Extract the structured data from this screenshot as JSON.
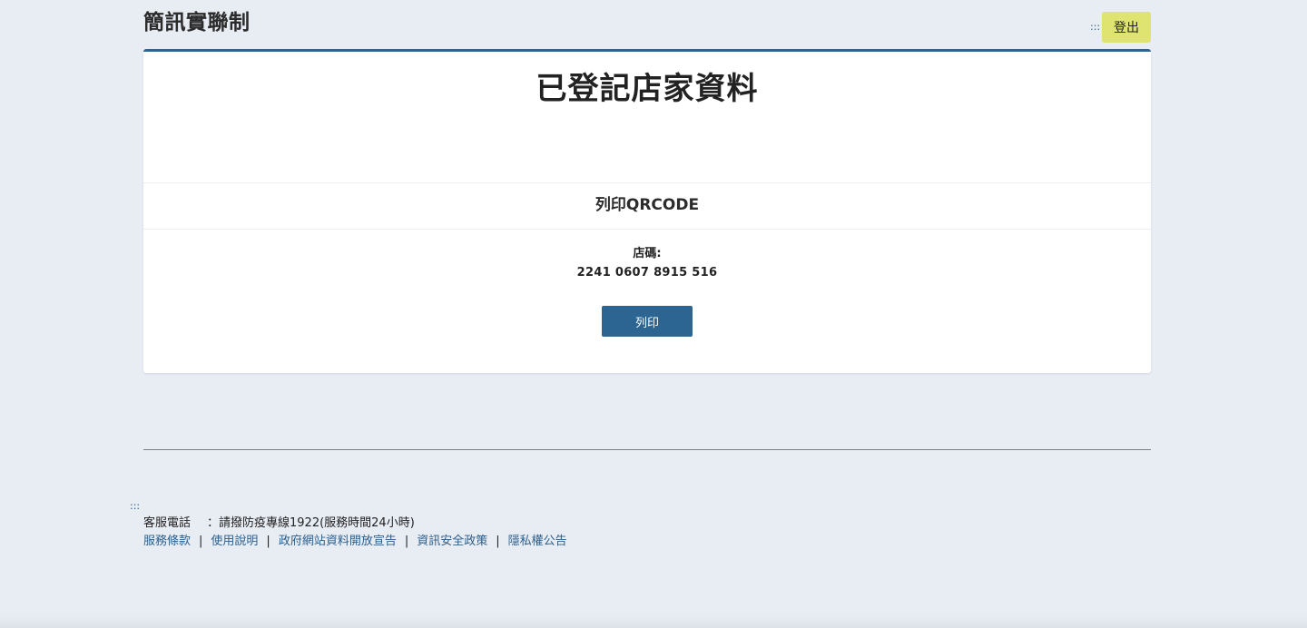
{
  "header": {
    "site_title": "簡訊實聯制",
    "accesskey_top": ":::",
    "logout_label": "登出"
  },
  "card": {
    "title": "已登記店家資料",
    "section_heading": "列印QRCODE",
    "store_code_label": "店碼:",
    "store_code_value": "2241 0607 8915 516",
    "print_label": "列印"
  },
  "footer": {
    "accesskey_bottom": ":::",
    "phone_label": "客服電話",
    "phone_text": "：請撥防疫專線1922(服務時間24小時)",
    "links": [
      {
        "label": "服務條款"
      },
      {
        "label": "使用說明"
      },
      {
        "label": "政府網站資料開放宣告"
      },
      {
        "label": "資訊安全政策"
      },
      {
        "label": "隱私權公告"
      }
    ],
    "separator": "|"
  },
  "colors": {
    "background": "#e8ecf3",
    "accent_blue": "#2c6592",
    "logout_yellow": "#dfe36f",
    "link_blue": "#2b5f8c"
  }
}
